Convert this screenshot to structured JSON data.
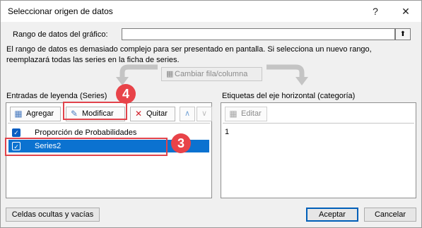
{
  "window": {
    "title": "Seleccionar origen de datos",
    "help_label": "?",
    "close_label": "✕"
  },
  "range": {
    "label": "Rango de datos del gráfico:",
    "value": "",
    "picker_icon": "⬆"
  },
  "message": {
    "line1": "El rango de datos es demasiado complejo para ser presentado en pantalla. Si selecciona un nuevo rango,",
    "line2": "reemplazará todas las series en la ficha de series."
  },
  "switch_button": "Cambiar fila/columna",
  "legend_panel": {
    "title": "Entradas de leyenda (Series)",
    "add_label": "Agregar",
    "edit_label": "Modificar",
    "remove_label": "Quitar",
    "up_icon": "∧",
    "down_icon": "∨",
    "items": [
      {
        "label": "Proporción de Probabilidades",
        "checked": true,
        "selected": false
      },
      {
        "label": "Series2",
        "checked": true,
        "selected": true
      }
    ]
  },
  "axis_panel": {
    "title": "Etiquetas del eje horizontal (categoría)",
    "edit_label": "Editar",
    "items": [
      "1"
    ]
  },
  "footer": {
    "hidden_cells_label": "Celdas ocultas y vacías",
    "ok_label": "Aceptar",
    "cancel_label": "Cancelar"
  },
  "annotations": {
    "badge_modify": "4",
    "badge_series": "3",
    "accent_color": "#e0434b"
  }
}
